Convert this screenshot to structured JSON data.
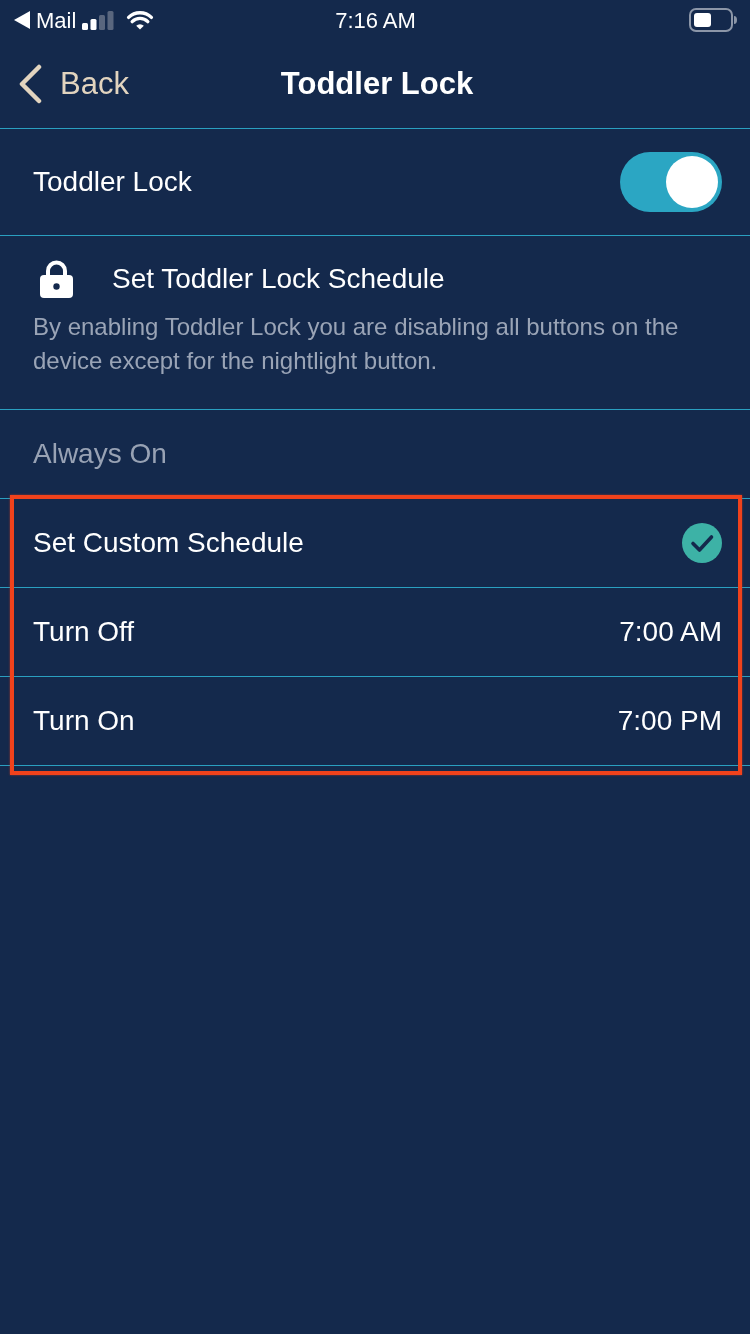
{
  "status_bar": {
    "back_app": "Mail",
    "time": "7:16 AM"
  },
  "nav": {
    "back": "Back",
    "title": "Toddler Lock"
  },
  "toggle_row": {
    "label": "Toddler Lock",
    "on": true
  },
  "schedule_header": {
    "title": "Set Toddler Lock Schedule",
    "description": "By enabling Toddler Lock you are disabling all buttons on the device except for the nightlight button."
  },
  "options": [
    {
      "label": "Always On",
      "selected": false
    },
    {
      "label": "Set Custom Schedule",
      "selected": true
    }
  ],
  "times": [
    {
      "label": "Turn Off",
      "value": "7:00 AM"
    },
    {
      "label": "Turn On",
      "value": "7:00 PM"
    }
  ],
  "highlight_frame": true
}
